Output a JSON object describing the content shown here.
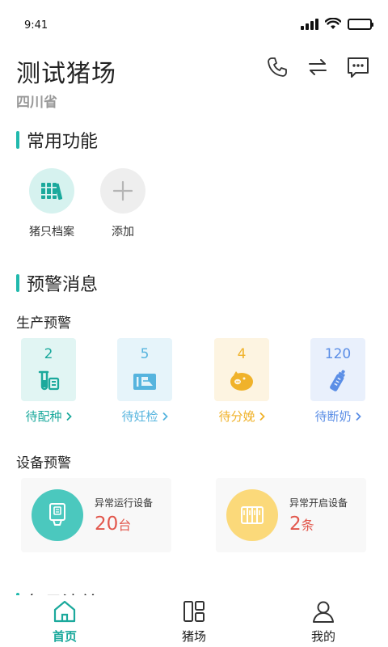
{
  "status_bar": {
    "time": "9:41",
    "icons": [
      "signal-icon",
      "wifi-icon",
      "battery-icon"
    ]
  },
  "header": {
    "title": "测试猪场",
    "region": "四川省",
    "actions": [
      "phone-icon",
      "switch-icon",
      "message-icon"
    ]
  },
  "common_functions": {
    "title": "常用功能",
    "items": [
      {
        "label": "猪只档案",
        "icon": "pig-archive-icon"
      },
      {
        "label": "添加",
        "icon": "plus-icon"
      }
    ]
  },
  "warnings": {
    "title": "预警消息",
    "production": {
      "title": "生产预警",
      "items": [
        {
          "count": "2",
          "label": "待配种",
          "icon": "test-tube-icon",
          "color": "#1ba99c",
          "bg": "#e1f5f3"
        },
        {
          "count": "5",
          "label": "待妊检",
          "icon": "scanner-icon",
          "color": "#56b4de",
          "bg": "#e6f4fa"
        },
        {
          "count": "4",
          "label": "待分娩",
          "icon": "piggy-icon",
          "color": "#f0b22a",
          "bg": "#fdf4e1"
        },
        {
          "count": "120",
          "label": "待断奶",
          "icon": "baby-bottle-icon",
          "color": "#5b8ee6",
          "bg": "#e9f0fc"
        }
      ]
    },
    "device": {
      "title": "设备预警",
      "items": [
        {
          "name": "异常运行设备",
          "count": "20",
          "unit": "台",
          "icon": "device-running-icon"
        },
        {
          "name": "异常开启设备",
          "count": "2",
          "unit": "条",
          "icon": "device-open-icon"
        }
      ]
    }
  },
  "next_section": {
    "title": "每日清单"
  },
  "tab_bar": {
    "tabs": [
      {
        "label": "首页",
        "icon": "home-icon",
        "active": true
      },
      {
        "label": "猪场",
        "icon": "farm-grid-icon",
        "active": false
      },
      {
        "label": "我的",
        "icon": "user-icon",
        "active": false
      }
    ]
  },
  "colors": {
    "accent": "#21b9ad",
    "active_tab": "#1ba99c",
    "alert_count": "#e2574c"
  }
}
